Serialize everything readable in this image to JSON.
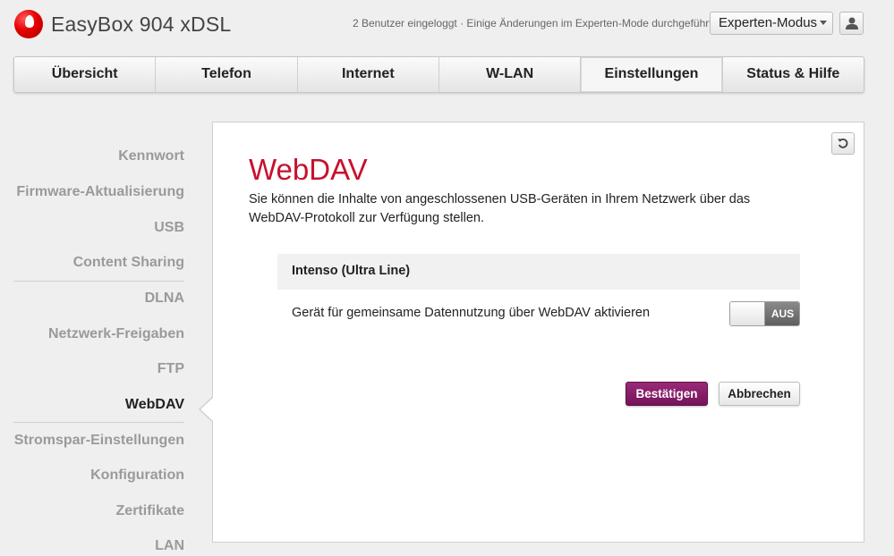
{
  "header": {
    "app_title": "EasyBox 904 xDSL",
    "status_text": "2 Benutzer eingeloggt · Einige Änderungen im Experten-Mode durchgeführt",
    "mode_select_value": "Experten-Modus",
    "brand_color": "#e60000"
  },
  "nav": {
    "tabs": [
      {
        "label": "Übersicht"
      },
      {
        "label": "Telefon"
      },
      {
        "label": "Internet"
      },
      {
        "label": "W-LAN"
      },
      {
        "label": "Einstellungen"
      },
      {
        "label": "Status & Hilfe"
      }
    ],
    "active_tab": "Einstellungen"
  },
  "sidebar": {
    "items": [
      {
        "label": "Kennwort"
      },
      {
        "label": "Firmware-Aktualisierung"
      },
      {
        "label": "USB"
      },
      {
        "label": "Content Sharing"
      },
      {
        "label": "DLNA"
      },
      {
        "label": "Netzwerk-Freigaben"
      },
      {
        "label": "FTP"
      },
      {
        "label": "WebDAV"
      },
      {
        "label": "Stromspar-Einstellungen"
      },
      {
        "label": "Konfiguration"
      },
      {
        "label": "Zertifikate"
      },
      {
        "label": "LAN"
      }
    ],
    "active_item": "WebDAV"
  },
  "main": {
    "title": "WebDAV",
    "description": "Sie können die Inhalte von angeschlossenen USB-Geräten in Ihrem Netzwerk über das WebDAV-Protokoll zur Verfügung stellen.",
    "device_name": "Intenso (Ultra Line)",
    "option_label": "Gerät für gemeinsame Datennutzung über WebDAV aktivieren",
    "toggle_state": "AUS",
    "confirm_label": "Bestätigen",
    "cancel_label": "Abbrechen",
    "title_color": "#c8102e",
    "confirm_color": "#8a1f6c"
  }
}
